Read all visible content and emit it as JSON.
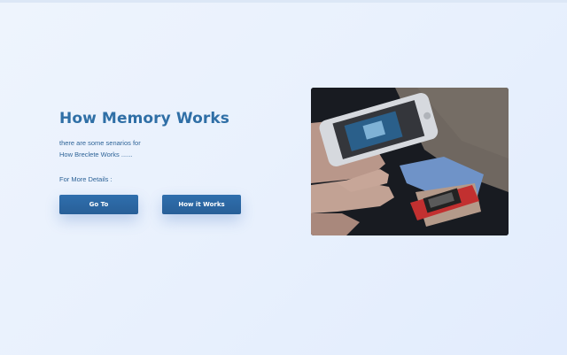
{
  "hero": {
    "title": "How Memory Works",
    "description_lines": [
      "there are some senarios for",
      "How Breclete Works ......"
    ],
    "details_label": "For More Details :",
    "buttons": {
      "go_to": "Go To",
      "how_it_works": "How it Works"
    }
  },
  "colors": {
    "accent": "#2f6fa6",
    "button": "#2b67a3",
    "background": "#eaf2fd"
  },
  "image": {
    "icon": "phone-scanning-bracelet-photo"
  }
}
